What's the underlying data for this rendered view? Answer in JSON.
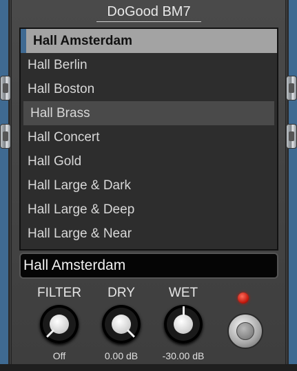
{
  "title": "DoGood BM7",
  "presets": [
    "Hall Amsterdam",
    "Hall Berlin",
    "Hall Boston",
    "Hall Brass",
    "Hall Concert",
    "Hall Gold",
    "Hall Large & Dark",
    "Hall Large & Deep",
    "Hall Large & Near"
  ],
  "selected_preset": "Hall Amsterdam",
  "current_preset_name": "Hall Amsterdam",
  "knobs": {
    "filter": {
      "label": "FILTER",
      "value": "Off"
    },
    "dry": {
      "label": "DRY",
      "value": "0.00 dB"
    },
    "wet": {
      "label": "WET",
      "value": "-30.00 dB"
    }
  },
  "colors": {
    "accent": "#3f6a92",
    "led": "#c0180c",
    "selected_row": "#a3a3a3"
  }
}
